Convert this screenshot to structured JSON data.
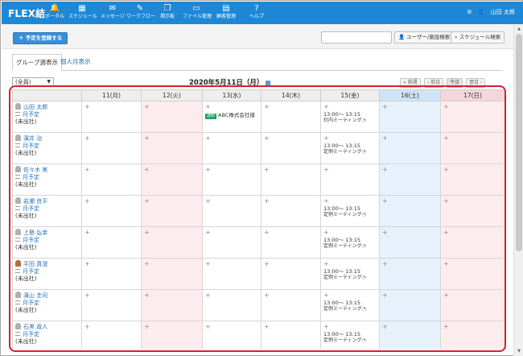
{
  "app": {
    "logo": "FLEX結"
  },
  "nav": [
    {
      "label": "ポータル",
      "icon": "bell-icon",
      "glyph": "🔔"
    },
    {
      "label": "スケジュール",
      "icon": "calendar-icon",
      "glyph": "▦"
    },
    {
      "label": "メッセージ",
      "icon": "envelope-icon",
      "glyph": "✉"
    },
    {
      "label": "ワークフロー",
      "icon": "workflow-icon",
      "glyph": "✎"
    },
    {
      "label": "掲示板",
      "icon": "board-icon",
      "glyph": "❐"
    },
    {
      "label": "ファイル管理",
      "icon": "folder-icon",
      "glyph": "▭"
    },
    {
      "label": "顧客管理",
      "icon": "customer-icon",
      "glyph": "▤"
    },
    {
      "label": "ヘルプ",
      "icon": "help-icon",
      "glyph": "?"
    }
  ],
  "user": {
    "settings_glyph": "⚙",
    "name": "山田 太郎",
    "person_glyph": "👤"
  },
  "toolbar": {
    "add_schedule_label": "＋ 予定を登録する",
    "search_value": "",
    "user_search_label": "ユーザー/施設検索",
    "schedule_search_label": "スケジュール検索"
  },
  "tabs": {
    "group_week": "グループ週表示",
    "personal_month": "個人月表示"
  },
  "calendar": {
    "group_selected": "(全員)",
    "date_title": "2020年5月11日（月）",
    "nav": {
      "prev_week": "« 前週",
      "prev_day": "‹ 前日",
      "today": "今日",
      "next_day": "翌日 ›"
    }
  },
  "days": [
    "11(月)",
    "12(火)",
    "13(水)",
    "14(木)",
    "15(金)",
    "16(土)",
    "17(日)"
  ],
  "member_labels": {
    "month": "月予定",
    "status": "(未出社)"
  },
  "colors": {
    "header_blue": "#1e88d6",
    "sat_bg": "#e6f1fb",
    "sun_bg": "#fcecee",
    "highlight": "#d8202b"
  },
  "members": [
    {
      "name": "山田 太郎",
      "photo": false,
      "events": {
        "2": {
          "tag": "通知",
          "company": "ABC株式会社様"
        },
        "4": {
          "time": "13:00～ 13:15",
          "title": "社内ミーティング"
        }
      }
    },
    {
      "name": "濱井 治",
      "photo": false,
      "events": {
        "4": {
          "time": "13:00～ 13:15",
          "title": "定例ミーティング"
        }
      }
    },
    {
      "name": "佐々木 実",
      "photo": false,
      "events": {}
    },
    {
      "name": "岩瀬 良平",
      "photo": false,
      "events": {
        "4": {
          "time": "13:00～ 13:15",
          "title": "定例ミーティング"
        }
      }
    },
    {
      "name": "上懸 弘幸",
      "photo": false,
      "events": {
        "4": {
          "time": "13:00～ 13:15",
          "title": "定例ミーティング"
        }
      }
    },
    {
      "name": "平田 真澄",
      "photo": true,
      "events": {
        "4": {
          "time": "13:00～ 13:15",
          "title": "定例ミーティング"
        }
      }
    },
    {
      "name": "濱山 圭司",
      "photo": false,
      "events": {
        "4": {
          "time": "13:00～ 13:15",
          "title": "定例ミーティング"
        }
      }
    },
    {
      "name": "石黒 政人",
      "photo": false,
      "events": {
        "4": {
          "time": "13:00～ 13:15",
          "title": "定例ミーティング"
        }
      }
    }
  ]
}
